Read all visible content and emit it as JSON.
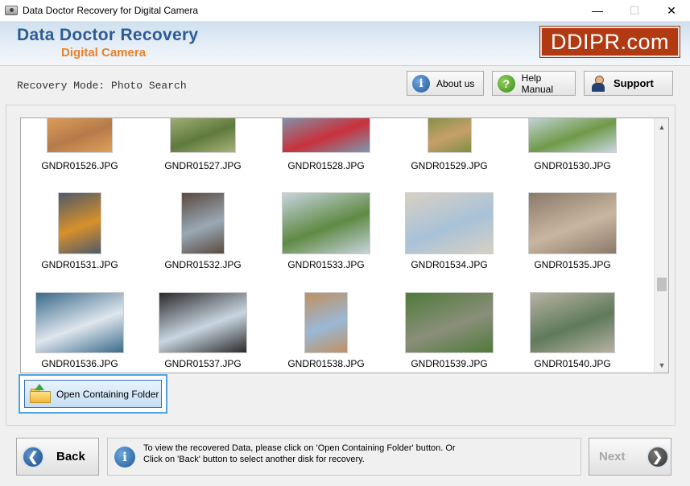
{
  "window": {
    "title": "Data Doctor Recovery for Digital Camera",
    "minimize_icon": "minimize-icon",
    "maximize_icon": "maximize-icon",
    "close_icon": "close-icon"
  },
  "banner": {
    "title": "Data Doctor Recovery",
    "subtitle": "Digital Camera",
    "logo": "DDIPR.com"
  },
  "mode": {
    "label": "Recovery Mode: Photo Search"
  },
  "toolbar": {
    "about_label": "About us",
    "help_label": "Help Manual",
    "support_label": "Support"
  },
  "gallery": {
    "rows": [
      [
        {
          "name": "GNDR01526.JPG",
          "color1": "#b57a4a",
          "color2": "#e0a05a"
        },
        {
          "name": "GNDR01527.JPG",
          "color1": "#5f7a3c",
          "color2": "#a5b27a"
        },
        {
          "name": "GNDR01528.JPG",
          "color1": "#c9313c",
          "color2": "#7a9ab0"
        },
        {
          "name": "GNDR01529.JPG",
          "color1": "#c7a06a",
          "color2": "#7e8f44"
        },
        {
          "name": "GNDR01530.JPG",
          "color1": "#6f9a48",
          "color2": "#c8d7e2"
        }
      ],
      [
        {
          "name": "GNDR01531.JPG",
          "color1": "#d8902a",
          "color2": "#4f5a6a"
        },
        {
          "name": "GNDR01532.JPG",
          "color1": "#9aa9b5",
          "color2": "#5a4a40"
        },
        {
          "name": "GNDR01533.JPG",
          "color1": "#5f8a44",
          "color2": "#c7d4de"
        },
        {
          "name": "GNDR01534.JPG",
          "color1": "#a8c2d8",
          "color2": "#d8d0c4"
        },
        {
          "name": "GNDR01535.JPG",
          "color1": "#c9b6a0",
          "color2": "#8a7a6a"
        }
      ],
      [
        {
          "name": "GNDR01536.JPG",
          "color1": "#dfe6ee",
          "color2": "#3a6a8a"
        },
        {
          "name": "GNDR01537.JPG",
          "color1": "#c9d6e2",
          "color2": "#2a2a2a"
        },
        {
          "name": "GNDR01538.JPG",
          "color1": "#9ab8d6",
          "color2": "#c09060"
        },
        {
          "name": "GNDR01539.JPG",
          "color1": "#8a8f7a",
          "color2": "#4f7a3a"
        },
        {
          "name": "GNDR01540.JPG",
          "color1": "#5f7a5a",
          "color2": "#b7b2a4"
        }
      ]
    ]
  },
  "open_folder": {
    "label": "Open Containing Folder"
  },
  "bottom": {
    "back_label": "Back",
    "next_label": "Next",
    "info_line1": "To view the recovered Data, please click on 'Open Containing Folder' button. Or",
    "info_line2": "Click on 'Back' button to select another disk for recovery."
  }
}
